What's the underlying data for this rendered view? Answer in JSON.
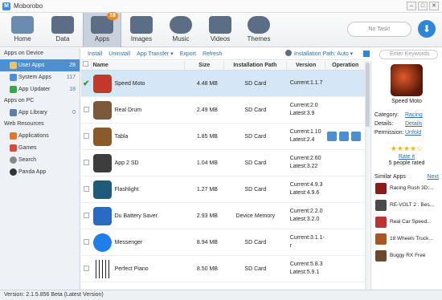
{
  "window": {
    "title": "Moborobo",
    "logo": "M",
    "min": "–",
    "max": "□",
    "close": "✕"
  },
  "nav": [
    {
      "label": "Home",
      "icon": "welcome-home-icon"
    },
    {
      "label": "Data",
      "icon": "data-icon"
    },
    {
      "label": "Apps",
      "icon": "apps-icon",
      "badge": "18"
    },
    {
      "label": "Images",
      "icon": "images-icon"
    },
    {
      "label": "Music",
      "icon": "music-icon"
    },
    {
      "label": "Videos",
      "icon": "videos-icon"
    },
    {
      "label": "Themes",
      "icon": "themes-icon"
    }
  ],
  "task": {
    "label": "No Task!"
  },
  "sidebar": {
    "device_title": "Apps on Device",
    "user_apps": {
      "label": "User Apps",
      "count": "28"
    },
    "system_apps": {
      "label": "System Apps",
      "count": "117"
    },
    "app_updater": {
      "label": "App Updater",
      "count": "18"
    },
    "pc_title": "Apps on PC",
    "app_library": {
      "label": "App Library",
      "count": "0"
    },
    "web_title": "Web Resources",
    "applications": "Applications",
    "games": "Games",
    "search": "Search",
    "panda": "Panda App"
  },
  "actions": {
    "install": "Install",
    "uninstall": "Uninstall",
    "app_transfer": "App Transfer ▾",
    "export": "Export",
    "refresh": "Refresh",
    "install_path": "Installation Path: Auto ▾",
    "search_placeholder": "Enter Keywords"
  },
  "columns": {
    "name": "Name",
    "size": "Size",
    "path": "Installation Path",
    "version": "Version",
    "operation": "Operation"
  },
  "apps": [
    {
      "name": "Speed Moto",
      "size": "4.48 MB",
      "path": "SD Card",
      "current": "Current:1.1.7",
      "latest": "",
      "color": "#c0392b"
    },
    {
      "name": "Real Drum",
      "size": "2.49 MB",
      "path": "SD Card",
      "current": "Current:2.0",
      "latest": "Latest:3.9",
      "color": "#7a5a3a"
    },
    {
      "name": "Tabla",
      "size": "1.85 MB",
      "path": "SD Card",
      "current": "Current:1.10",
      "latest": "Latest:2.4",
      "color": "#8a5a2a"
    },
    {
      "name": "App 2 SD",
      "size": "1.04 MB",
      "path": "SD Card",
      "current": "Current:2.60",
      "latest": "Latest:3.22",
      "color": "#3d3d3d"
    },
    {
      "name": "Flashlight",
      "size": "1.27 MB",
      "path": "SD Card",
      "current": "Current:4.9.3",
      "latest": "Latest:4.9.6",
      "color": "#1e5a7a"
    },
    {
      "name": "Du Battery Saver",
      "size": "2.93 MB",
      "path": "Device Memory",
      "current": "Current:2.2.0",
      "latest": "Latest:3.2.0",
      "color": "#2a6ac0"
    },
    {
      "name": "Messenger",
      "size": "8.94 MB",
      "path": "SD Card",
      "current": "Current:3.1.1-r",
      "latest": "",
      "color": "#1f7ee8"
    },
    {
      "name": "Perfect Piano",
      "size": "8.50 MB",
      "path": "SD Card",
      "current": "Current:5.8.3",
      "latest": "Latest:5.9.1",
      "color": "#222222"
    }
  ],
  "detail": {
    "name": "Speed Moto",
    "category_label": "Category:",
    "category": "Racing",
    "details_label": "Details:",
    "details": "Details",
    "permission_label": "Permission:",
    "permission": "Unfold",
    "stars": "★★★★☆",
    "rating": 4,
    "rate_it": "Rate it",
    "rated": "5 people rated",
    "similar_label": "Similar Apps",
    "next": "Next",
    "similar": [
      {
        "name": "Racing Rush 3D:...",
        "color": "#8b1a1a"
      },
      {
        "name": "RE-VOLT 2 : Bes...",
        "color": "#4a4a4a"
      },
      {
        "name": "Real Car Speed...",
        "color": "#b33"
      },
      {
        "name": "18 Wheels Truck...",
        "color": "#a52"
      },
      {
        "name": "Buggy RX Free",
        "color": "#6a4a2a"
      }
    ]
  },
  "status": "Version: 2.1.5.856 Beta  (Latest Version)"
}
